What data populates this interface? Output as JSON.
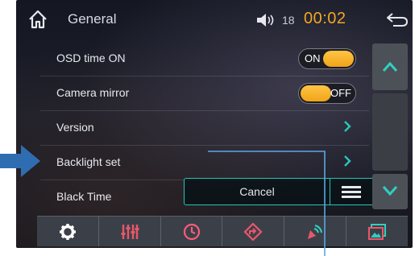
{
  "header": {
    "title": "General",
    "volume": "18",
    "time": "00:02"
  },
  "settings": {
    "items": [
      {
        "label": "OSD time ON",
        "control": "toggle",
        "state": "ON"
      },
      {
        "label": "Camera mirror",
        "control": "toggle",
        "state": "OFF"
      },
      {
        "label": "Version",
        "control": "chevron"
      },
      {
        "label": "Backlight set",
        "control": "chevron"
      },
      {
        "label": "Black Time",
        "control": "select"
      }
    ],
    "black_time_value": "Cancel"
  },
  "toolbar": {
    "tabs": [
      "settings-gear-icon",
      "equalizer-icon",
      "clock-icon",
      "navigation-icon",
      "bluetooth-icon",
      "gallery-icon"
    ]
  },
  "colors": {
    "accent_orange": "#f5a623",
    "accent_teal": "#27c4b8",
    "annotation_blue": "#2f6db3"
  }
}
